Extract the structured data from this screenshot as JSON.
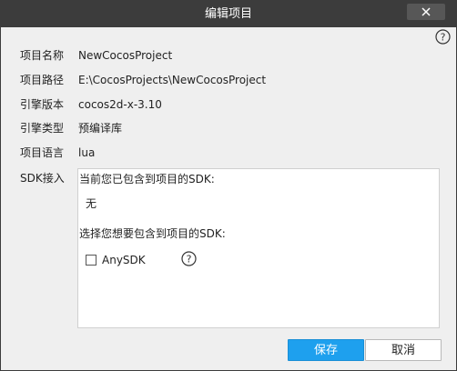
{
  "window": {
    "title": "编辑项目"
  },
  "fields": [
    {
      "label": "项目名称",
      "value": "NewCocosProject"
    },
    {
      "label": "项目路径",
      "value": "E:\\CocosProjects\\NewCocosProject"
    },
    {
      "label": "引擎版本",
      "value": "cocos2d-x-3.10"
    },
    {
      "label": "引擎类型",
      "value": "预编译库"
    },
    {
      "label": "项目语言",
      "value": "lua"
    }
  ],
  "sdk": {
    "label": "SDK接入",
    "included_heading": "当前您已包含到项目的SDK:",
    "included_value": "无",
    "choose_heading": "选择您想要包含到项目的SDK:",
    "options": [
      {
        "label": "AnySDK",
        "checked": false
      }
    ]
  },
  "buttons": {
    "save": "保存",
    "cancel": "取消"
  },
  "colors": {
    "titlebar": "#3c3c3c",
    "dialog_bg": "#efefef",
    "primary": "#1ea0ee"
  },
  "icons": {
    "close": "close-icon",
    "help": "help-icon"
  }
}
